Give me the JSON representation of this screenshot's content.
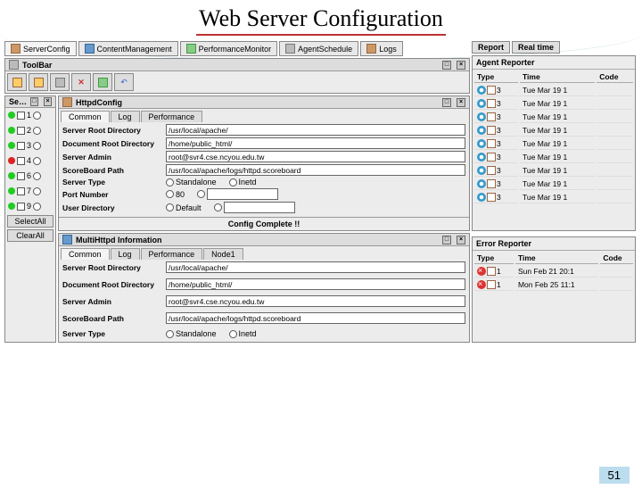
{
  "page": {
    "title": "Web Server Configuration",
    "page_number": "51"
  },
  "topTabs": [
    {
      "label": "ServerConfig"
    },
    {
      "label": "ContentManagement"
    },
    {
      "label": "PerformanceMonitor"
    },
    {
      "label": "AgentSchedule"
    },
    {
      "label": "Logs"
    }
  ],
  "toolbar": {
    "title": "ToolBar",
    "buttons": [
      "find-icon",
      "find-next-icon",
      "stop-icon",
      "delete-icon",
      "refresh-icon",
      "undo-icon"
    ]
  },
  "selection": {
    "title": "Se…",
    "items": [
      "1",
      "2",
      "3",
      "4",
      "6",
      "7",
      "9"
    ],
    "status": [
      "g",
      "g",
      "g",
      "r",
      "g",
      "g",
      "g"
    ],
    "selectAll": "SelectAll",
    "clearAll": "ClearAll"
  },
  "httpd": {
    "title": "HttpdConfig",
    "subtabs": [
      "Common",
      "Log",
      "Performance"
    ],
    "fields": {
      "root_lbl": "Server Root Directory",
      "root_val": "/usr/local/apache/",
      "doc_lbl": "Document Root Directory",
      "doc_val": "/home/public_html/",
      "admin_lbl": "Server Admin",
      "admin_val": "root@svr4.cse.ncyou.edu.tw",
      "score_lbl": "ScoreBoard Path",
      "score_val": "/usr/local/apache/logs/httpd.scoreboard",
      "type_lbl": "Server Type",
      "type_a": "Standalone",
      "type_b": "Inetd",
      "port_lbl": "Port Number",
      "port_val": "80",
      "udir_lbl": "User Directory",
      "udir_a": "Default"
    },
    "status": "Config Complete !!"
  },
  "multi": {
    "title": "MultiHttpd Information",
    "subtabs": [
      "Common",
      "Log",
      "Performance",
      "Node1"
    ],
    "fields": {
      "root_lbl": "Server Root Directory",
      "root_val": "/usr/local/apache/",
      "doc_lbl": "Document Root Directory",
      "doc_val": "/home/public_html/",
      "admin_lbl": "Server Admin",
      "admin_val": "root@svr4.cse.ncyou.edu.tw",
      "score_lbl": "ScoreBoard Path",
      "score_val": "/usr/local/apache/logs/httpd.scoreboard",
      "type_lbl": "Server Type",
      "type_a": "Standalone",
      "type_b": "Inetd"
    }
  },
  "reporter": {
    "tabs": [
      "Report",
      "Real time"
    ],
    "agent_title": "Agent Reporter",
    "agent_cols": [
      "Type",
      "Time",
      "Code"
    ],
    "agent_rows": [
      {
        "type": "3",
        "time": "Tue Mar 19 1"
      },
      {
        "type": "3",
        "time": "Tue Mar 19 1"
      },
      {
        "type": "3",
        "time": "Tue Mar 19 1"
      },
      {
        "type": "3",
        "time": "Tue Mar 19 1"
      },
      {
        "type": "3",
        "time": "Tue Mar 19 1"
      },
      {
        "type": "3",
        "time": "Tue Mar 19 1"
      },
      {
        "type": "3",
        "time": "Tue Mar 19 1"
      },
      {
        "type": "3",
        "time": "Tue Mar 19 1"
      },
      {
        "type": "3",
        "time": "Tue Mar 19 1"
      }
    ],
    "error_title": "Error Reporter",
    "error_cols": [
      "Type",
      "Time",
      "Code"
    ],
    "error_rows": [
      {
        "type": "1",
        "time": "Sun Feb 21 20:1"
      },
      {
        "type": "1",
        "time": "Mon Feb 25 11:1"
      }
    ]
  }
}
